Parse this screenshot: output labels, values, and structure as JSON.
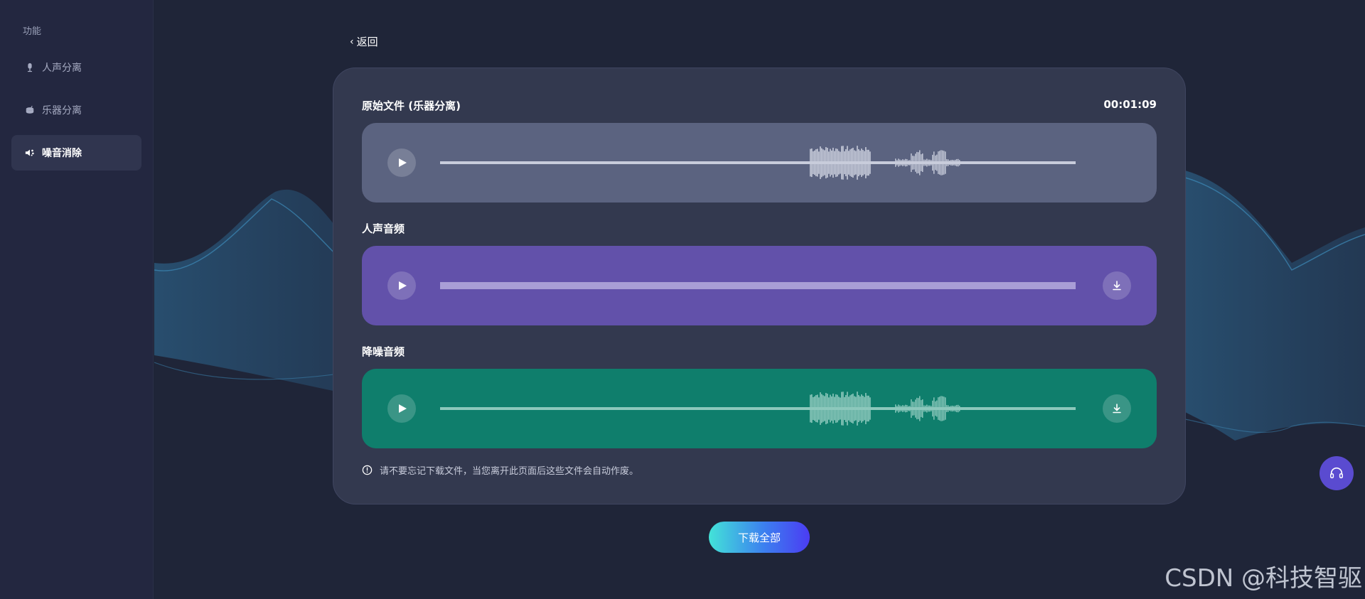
{
  "sidebar": {
    "heading": "功能",
    "items": [
      {
        "label": "人声分离",
        "icon": "microphone-icon",
        "active": false
      },
      {
        "label": "乐器分离",
        "icon": "drum-icon",
        "active": false
      },
      {
        "label": "噪音消除",
        "icon": "noise-icon",
        "active": true
      }
    ]
  },
  "back": {
    "label": "返回"
  },
  "card": {
    "duration": "00:01:09",
    "tracks": [
      {
        "title": "原始文件 (乐器分离)",
        "color": "#5b6380",
        "downloadable": false
      },
      {
        "title": "人声音频",
        "color": "#6251aa",
        "downloadable": true
      },
      {
        "title": "降噪音频",
        "color": "#0f7e6c",
        "downloadable": true
      }
    ],
    "notice": "请不要忘记下载文件，当您离开此页面后这些文件会自动作废。"
  },
  "download_all": {
    "label": "下载全部"
  },
  "support": {
    "icon": "headset-icon"
  },
  "watermark": "CSDN @科技智驱",
  "colors": {
    "accent": "#5a4bd0",
    "background": "#1f2538"
  }
}
